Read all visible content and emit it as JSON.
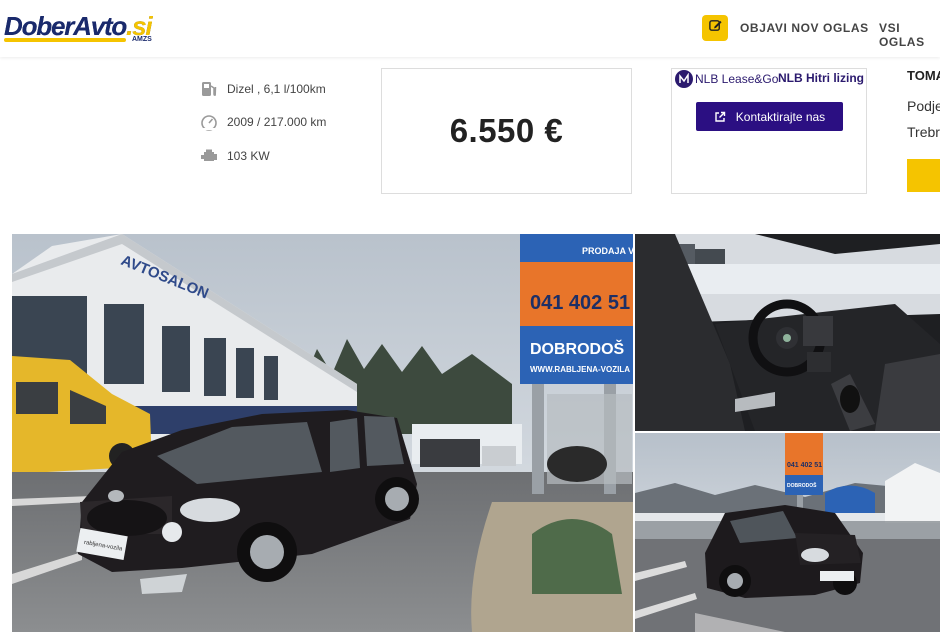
{
  "header": {
    "logo_text": "DoberAvto",
    "logo_tld": ".si",
    "logo_sub": "AMZS",
    "nav": {
      "publish_label": "OBJAVI NOV OGLAS",
      "all_label": "VSI OGLAS"
    }
  },
  "specs": [
    {
      "icon": "fuel-pump-icon",
      "text": "Dizel , 6,1 l/100km"
    },
    {
      "icon": "speedometer-icon",
      "text": "2009 / 217.000 km"
    },
    {
      "icon": "engine-icon",
      "text": "103 KW"
    }
  ],
  "price": "6.550 €",
  "leasing": {
    "brand": "NLB Lease&Go",
    "product": "NLB Hitri lizing",
    "contact_label": "Kontaktirajte nas"
  },
  "seller": {
    "name": "TOMA",
    "line1": "Podje",
    "line2": "Trebr"
  },
  "photos": {
    "main": {
      "building_sign": "AVTOSALON",
      "sign_top": "PRODAJA VOZ",
      "sign_phone": "041 402 51",
      "sign_welcome": "DOBRODOŠ",
      "sign_web": "WWW.RABLJENA-VOZILA",
      "plate": "rabljena-vozila"
    },
    "bottom_right": {
      "sign_phone": "041 402 51",
      "sign_welcome": "DOBRODOŠ"
    }
  },
  "colors": {
    "brand_navy": "#1a2a6c",
    "brand_yellow": "#f5c400",
    "leasing_purple": "#2b0f82"
  }
}
